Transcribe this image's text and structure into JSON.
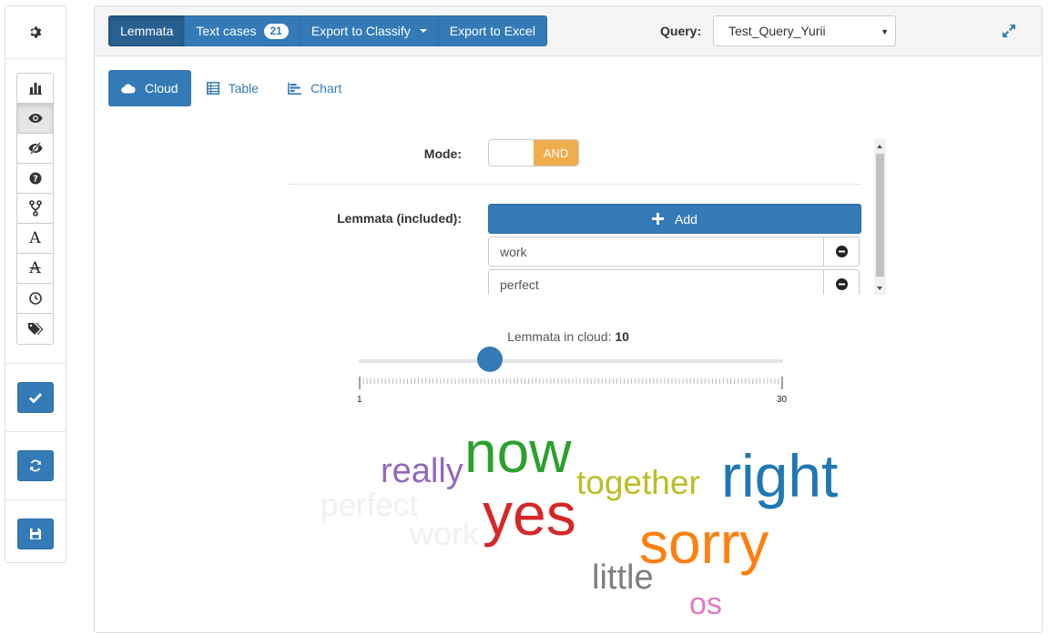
{
  "sidebar": {
    "settings_icon": "gear-icon",
    "tools": [
      {
        "name": "tool-statistics",
        "icon": "bar-chart-icon"
      },
      {
        "name": "tool-show",
        "icon": "eye-icon"
      },
      {
        "name": "tool-hide",
        "icon": "eye-slash-icon"
      },
      {
        "name": "tool-help",
        "icon": "question-circle-icon"
      },
      {
        "name": "tool-fork",
        "icon": "fork-icon"
      },
      {
        "name": "tool-font",
        "icon": "font-icon",
        "text": "A"
      },
      {
        "name": "tool-strikethrough",
        "icon": "strikethrough-icon",
        "text": "A"
      },
      {
        "name": "tool-time",
        "icon": "clock-icon"
      },
      {
        "name": "tool-tags",
        "icon": "tags-icon"
      }
    ],
    "actions": [
      "check-icon",
      "refresh-icon",
      "save-icon"
    ]
  },
  "toolbar": {
    "buttons": {
      "lemmata": "Lemmata",
      "text_cases": "Text cases",
      "text_cases_count": "21",
      "export_classify": "Export to Classify",
      "export_excel": "Export to Excel"
    },
    "query_label": "Query:",
    "query_value": "Test_Query_Yurii"
  },
  "view_tabs": {
    "cloud": "Cloud",
    "table": "Table",
    "chart": "Chart"
  },
  "form": {
    "mode_label": "Mode:",
    "mode_value": "AND",
    "lemmata_label": "Lemmata (included):",
    "add_label": "Add",
    "lemmata": [
      "work",
      "perfect"
    ]
  },
  "slider": {
    "label": "Lemmata in cloud:",
    "value": "10",
    "min": "1",
    "max": "30"
  },
  "cloud": {
    "words": [
      {
        "text": "now",
        "color": "#2ca02c"
      },
      {
        "text": "right",
        "color": "#1f77b4"
      },
      {
        "text": "yes",
        "color": "#d62728"
      },
      {
        "text": "sorry",
        "color": "#ff7f0e"
      },
      {
        "text": "really",
        "color": "#9467bd"
      },
      {
        "text": "together",
        "color": "#bcbd22"
      },
      {
        "text": "perfect",
        "color": "#f0f0f0"
      },
      {
        "text": "work",
        "color": "#f0f0f0"
      },
      {
        "text": "little",
        "color": "#7f7f7f"
      },
      {
        "text": "os",
        "color": "#e377c2"
      }
    ]
  },
  "colors": {
    "primary": "#337ab7",
    "primary_active": "#286090",
    "toggle_on": "#f0ad4e"
  }
}
